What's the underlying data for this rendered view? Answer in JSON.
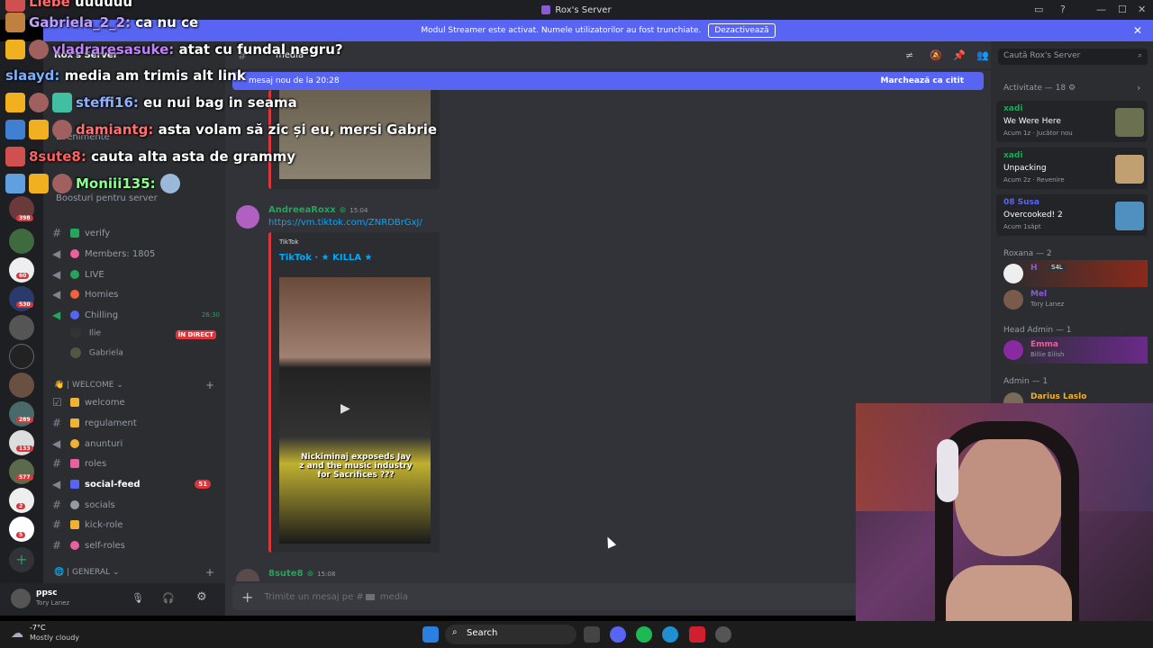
{
  "window": {
    "title": "Rox's Server"
  },
  "banner": {
    "text": "Modul Streamer este activat. Numele utilizatorilor au fost trunchiate.",
    "button": "Dezactivează"
  },
  "rail": {
    "badges": [
      "398",
      "60",
      "530",
      "289",
      "133",
      "577",
      "2",
      "5"
    ]
  },
  "sidebar": {
    "server_name": "Rox's Server",
    "top_items": [
      "Evenimente",
      "Boosturi pentru server"
    ],
    "channels_top": [
      {
        "label": "verify",
        "type": "text",
        "color": "#23a55a"
      },
      {
        "label": "Members: 1805",
        "type": "voice",
        "color": "#e8609c"
      },
      {
        "label": "LIVE",
        "type": "voice",
        "color": "#23a55a"
      },
      {
        "label": "Homies",
        "type": "voice",
        "color": "#f0613d"
      },
      {
        "label": "Chilling",
        "type": "voice",
        "color": "#5865f2",
        "timer": "26:30"
      }
    ],
    "voice_users": [
      {
        "name": "Ilie",
        "badge": "ÎN DIRECT"
      },
      {
        "name": "Gabriela"
      }
    ],
    "category_welcome": "| WELCOME",
    "channels_welcome": [
      {
        "label": "welcome",
        "type": "rules",
        "color": "#f0b232"
      },
      {
        "label": "regulament",
        "type": "text",
        "color": "#f0b232"
      },
      {
        "label": "anunturi",
        "type": "announce",
        "color": "#f0b232"
      },
      {
        "label": "roles",
        "type": "text",
        "color": "#e8609c"
      },
      {
        "label": "social-feed",
        "type": "announce",
        "color": "#5865f2",
        "unread": "51"
      },
      {
        "label": "socials",
        "type": "link",
        "color": "#949ba4"
      },
      {
        "label": "kick-role",
        "type": "text",
        "color": "#f0b232"
      },
      {
        "label": "self-roles",
        "type": "text",
        "color": "#e8609c"
      }
    ],
    "category_general": "| GENERAL"
  },
  "user_panel": {
    "name": "ppsc",
    "status": "Tory Lanez"
  },
  "main": {
    "channel": "media",
    "new_messages": "mesaj nou de la 20:28",
    "mark_read": "Marchează ca citit",
    "messages": [
      {
        "author": "AndreeaRoxx",
        "time": "15:04",
        "link": "https://vm.tiktok.com/ZNRDBrGxJ/",
        "embed_provider": "TikTok",
        "embed_title": "TikTok · ★ KILLA ★",
        "video_caption": "Nickiminaj exposeds Jay z and the music industry for Sacrifices ???"
      },
      {
        "author": "8sute8",
        "time": "15:08"
      }
    ],
    "composer_placeholder": "Trimite un mesaj pe #",
    "composer_channel": "media"
  },
  "members": {
    "search_placeholder": "Caută Rox's Server",
    "activity_header": "Activitate — 18",
    "activities": [
      {
        "name": "xadi",
        "game": "We Were Here",
        "time": "Acum 1z",
        "note": "Jucător nou"
      },
      {
        "name": "xadi",
        "game": "Unpacking",
        "time": "Acum 2z",
        "note": "Revenire"
      },
      {
        "name": "08 Susa",
        "game": "Overcooked! 2",
        "time": "Acum 1săpt",
        "note": ""
      }
    ],
    "sections": [
      {
        "title": "Roxana — 2",
        "members": [
          {
            "name": "H",
            "tag": "S4L",
            "status": ""
          },
          {
            "name": "Mel",
            "tag": "",
            "status": "Tory Lanez"
          }
        ]
      },
      {
        "title": "Head Admin — 1",
        "members": [
          {
            "name": "Emma",
            "tag": "",
            "status": "Billie Eilish"
          }
        ]
      },
      {
        "title": "Admin — 1",
        "members": [
          {
            "name": "Darius Laslo",
            "tag": "S4L",
            "status": ""
          }
        ]
      }
    ]
  },
  "chat_overlay": [
    {
      "user": "Liebe",
      "text": "uuuuuu",
      "color": "#ff6b6b"
    },
    {
      "user": "Gabriela_2_2:",
      "text": "ca nu ce",
      "color": "#c0a0ff"
    },
    {
      "user": "vladraresasuke:",
      "text": "atat cu fundal negru?",
      "color": "#c080ff"
    },
    {
      "user": "slaayd:",
      "text": "media am trimis alt link",
      "color": "#7fb0ff"
    },
    {
      "user": "steffi16:",
      "text": "eu nui bag in seama",
      "color": "#8fb0ff"
    },
    {
      "user": "damiantg:",
      "text": "asta volam să zic și eu, mersi Gabrie",
      "color": "#ff7070"
    },
    {
      "user": "8sute8:",
      "text": "cauta alta asta de grammy",
      "color": "#ff6060"
    },
    {
      "user": "Moniii135:",
      "text": "",
      "color": "#8fff8f"
    }
  ],
  "taskbar": {
    "weather_temp": "-7°C",
    "weather_desc": "Mostly cloudy",
    "search": "Search"
  },
  "colors": {
    "accent": "#5865f2",
    "online": "#23a55a",
    "alert": "#da373c"
  }
}
